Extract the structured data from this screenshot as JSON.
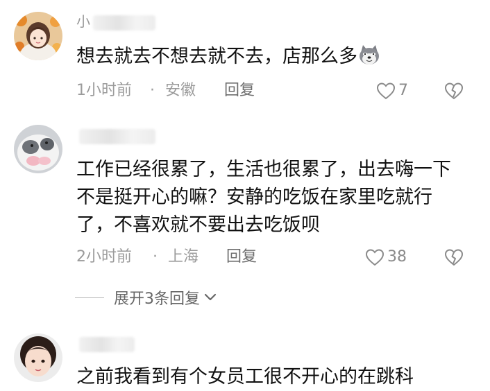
{
  "comments": [
    {
      "username": "小",
      "text": "想去就去不想去就不去，店那么多",
      "time": "1小时前",
      "separator": "·",
      "location": "安徽",
      "reply_label": "回复",
      "likes": "7",
      "emoji": "doge-emoji"
    },
    {
      "username": "",
      "text": "工作已经很累了，生活也很累了，出去嗨一下不是挺开心的嘛？安静的吃饭在家里吃就行了，不喜欢就不要出去吃饭呗",
      "time": "2小时前",
      "separator": "·",
      "location": "上海",
      "reply_label": "回复",
      "likes": "38",
      "expand_label": "展开3条回复"
    },
    {
      "username": "",
      "text": "之前我看到有个女员工很不开心的在跳科"
    }
  ],
  "icons": {
    "like": "heart-outline-icon",
    "dislike": "broken-heart-icon",
    "expand": "chevron-down-icon"
  },
  "colors": {
    "text": "#111111",
    "meta": "#9b9b9b",
    "reply": "#6e6e6e"
  }
}
